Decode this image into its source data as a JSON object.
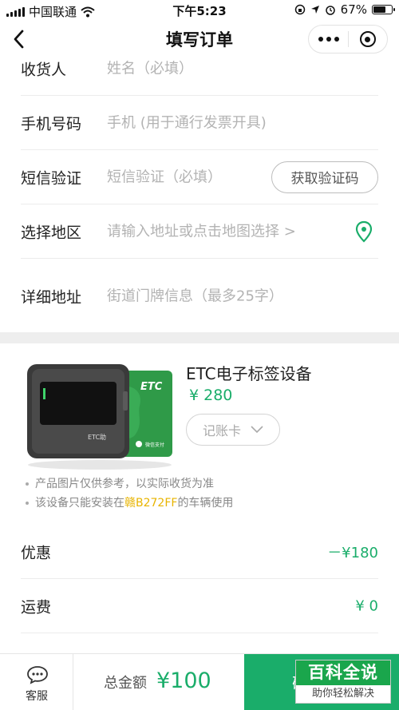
{
  "status_bar": {
    "carrier": "中国联通",
    "time": "下午5:23",
    "battery_percent": "67%",
    "battery_level": 0.67
  },
  "nav": {
    "title": "填写订单",
    "icons": [
      "back-icon",
      "more-icon",
      "close-icon"
    ]
  },
  "form": {
    "receiver": {
      "label": "收货人",
      "placeholder": "姓名（必填）"
    },
    "phone": {
      "label": "手机号码",
      "placeholder": "手机 (用于通行发票开具)"
    },
    "sms": {
      "label": "短信验证",
      "placeholder": "短信验证（必填）",
      "button": "获取验证码"
    },
    "region": {
      "label": "选择地区",
      "placeholder": "请输入地址或点击地图选择 >"
    },
    "address": {
      "label": "详细地址",
      "placeholder": "街道门牌信息（最多25字）"
    }
  },
  "product": {
    "name": "ETC电子标签设备",
    "price": "¥ 280",
    "card_type": "记账卡",
    "image_card_text": "ETC",
    "image_device_text": "ETC助",
    "image_pay_text": "微信支付",
    "notes": [
      "产品图片仅供参考，以实际收货为准"
    ],
    "plate_note_prefix": "该设备只能安装在",
    "plate": "赣B272FF",
    "plate_note_suffix": "的车辆使用"
  },
  "pricing": {
    "discount_label": "优惠",
    "discount_value": "－¥180",
    "shipping_label": "运费",
    "shipping_value": "¥ 0"
  },
  "bottom": {
    "service_label": "客服",
    "total_label": "总金额",
    "total_value": "¥100",
    "submit_label": "确"
  },
  "watermark": {
    "title": "百科全说",
    "subtitle": "助你轻松解决"
  },
  "colors": {
    "accent": "#1aad6a",
    "highlight": "#e8b400",
    "placeholder": "#b3b3b3"
  }
}
